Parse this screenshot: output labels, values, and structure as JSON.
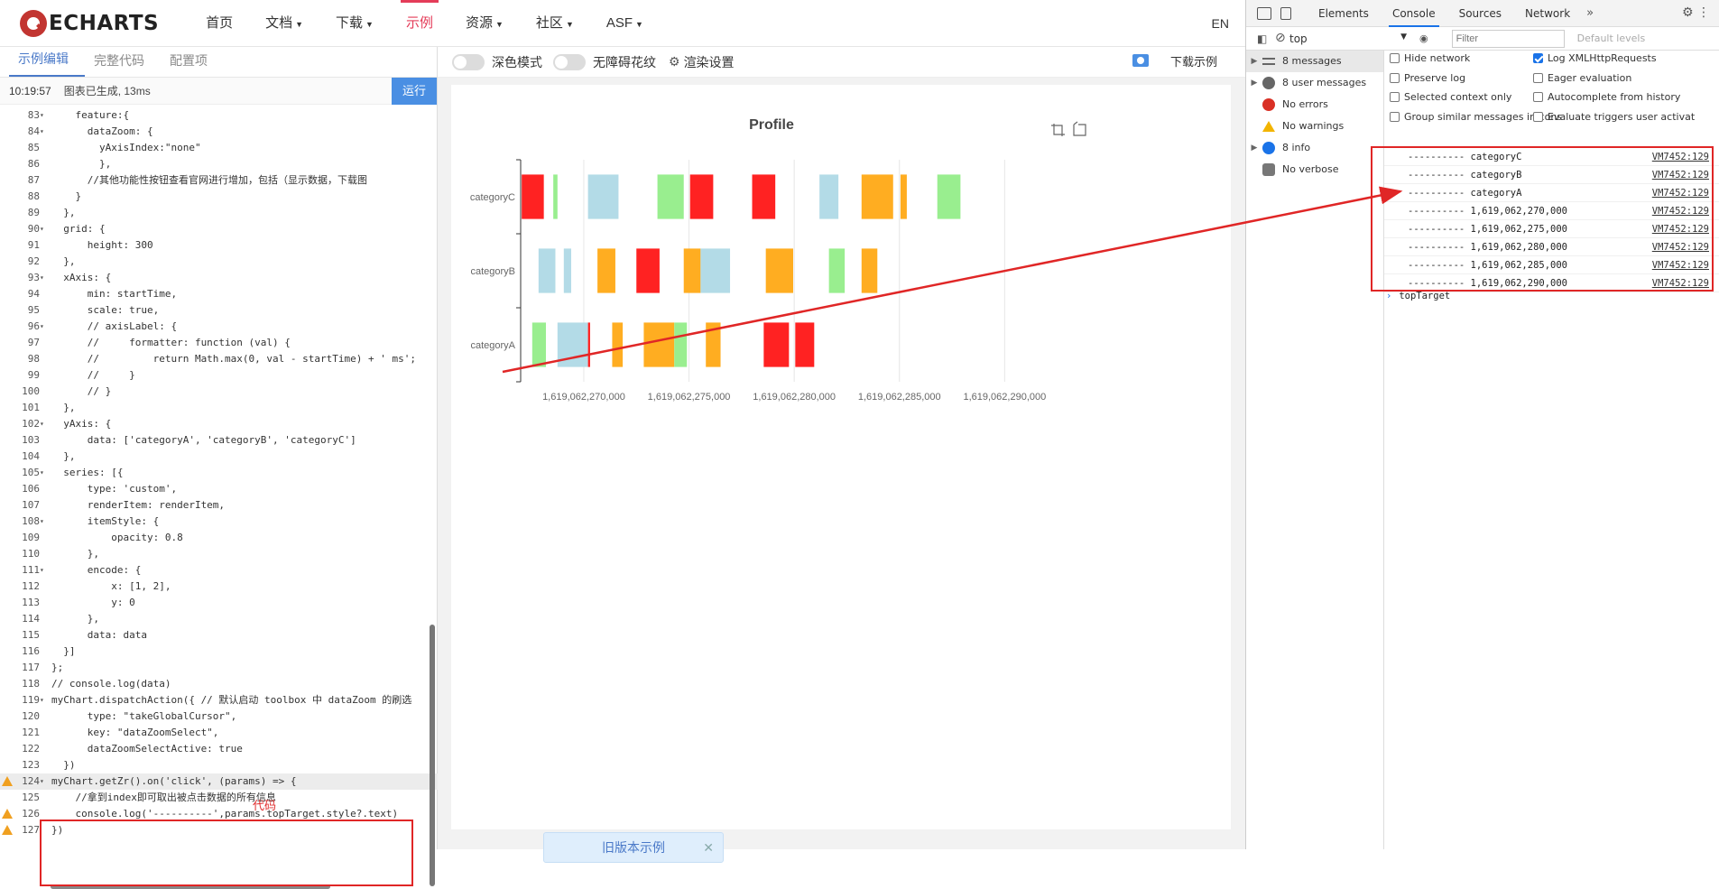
{
  "nav": {
    "logo_text": "ECHARTS",
    "items": [
      {
        "label": "首页",
        "has_caret": false
      },
      {
        "label": "文档",
        "has_caret": true
      },
      {
        "label": "下载",
        "has_caret": true
      },
      {
        "label": "示例",
        "has_caret": false,
        "active": true
      },
      {
        "label": "资源",
        "has_caret": true
      },
      {
        "label": "社区",
        "has_caret": true
      },
      {
        "label": "ASF",
        "has_caret": true
      }
    ],
    "lang": "EN"
  },
  "editor": {
    "tabs": [
      "示例编辑",
      "完整代码",
      "配置项"
    ],
    "status_time": "10:19:57",
    "status_msg": "图表已生成, 13ms",
    "run_label": "运行",
    "annotation": "代码",
    "lines": [
      {
        "n": "83",
        "fold": true,
        "text": "    feature:{"
      },
      {
        "n": "84",
        "fold": true,
        "text": "      dataZoom: {"
      },
      {
        "n": "85",
        "fold": false,
        "text": "        yAxisIndex:\"none\""
      },
      {
        "n": "86",
        "fold": false,
        "text": "        },"
      },
      {
        "n": "87",
        "fold": false,
        "text": "      //其他功能性按钮查看官网进行增加，包括（显示数据，下载图"
      },
      {
        "n": "88",
        "fold": false,
        "text": "    }"
      },
      {
        "n": "89",
        "fold": false,
        "text": "  },"
      },
      {
        "n": "90",
        "fold": true,
        "text": "  grid: {"
      },
      {
        "n": "91",
        "fold": false,
        "text": "      height: 300"
      },
      {
        "n": "92",
        "fold": false,
        "text": "  },"
      },
      {
        "n": "93",
        "fold": true,
        "text": "  xAxis: {"
      },
      {
        "n": "94",
        "fold": false,
        "text": "      min: startTime,"
      },
      {
        "n": "95",
        "fold": false,
        "text": "      scale: true,"
      },
      {
        "n": "96",
        "fold": true,
        "text": "      // axisLabel: {"
      },
      {
        "n": "97",
        "fold": false,
        "text": "      //     formatter: function (val) {"
      },
      {
        "n": "98",
        "fold": false,
        "text": "      //         return Math.max(0, val - startTime) + ' ms';"
      },
      {
        "n": "99",
        "fold": false,
        "text": "      //     }"
      },
      {
        "n": "100",
        "fold": false,
        "text": "      // }"
      },
      {
        "n": "101",
        "fold": false,
        "text": "  },"
      },
      {
        "n": "102",
        "fold": true,
        "text": "  yAxis: {"
      },
      {
        "n": "103",
        "fold": false,
        "text": "      data: ['categoryA', 'categoryB', 'categoryC']"
      },
      {
        "n": "104",
        "fold": false,
        "text": "  },"
      },
      {
        "n": "105",
        "fold": true,
        "text": "  series: [{"
      },
      {
        "n": "106",
        "fold": false,
        "text": "      type: 'custom',"
      },
      {
        "n": "107",
        "fold": false,
        "text": "      renderItem: renderItem,"
      },
      {
        "n": "108",
        "fold": true,
        "text": "      itemStyle: {"
      },
      {
        "n": "109",
        "fold": false,
        "text": "          opacity: 0.8"
      },
      {
        "n": "110",
        "fold": false,
        "text": "      },"
      },
      {
        "n": "111",
        "fold": true,
        "text": "      encode: {"
      },
      {
        "n": "112",
        "fold": false,
        "text": "          x: [1, 2],"
      },
      {
        "n": "113",
        "fold": false,
        "text": "          y: 0"
      },
      {
        "n": "114",
        "fold": false,
        "text": "      },"
      },
      {
        "n": "115",
        "fold": false,
        "text": "      data: data"
      },
      {
        "n": "116",
        "fold": false,
        "text": "  }]"
      },
      {
        "n": "117",
        "fold": false,
        "text": "};"
      },
      {
        "n": "118",
        "fold": false,
        "text": "// console.log(data)"
      },
      {
        "n": "119",
        "fold": true,
        "text": "myChart.dispatchAction({ // 默认启动 toolbox 中 dataZoom 的刷选"
      },
      {
        "n": "120",
        "fold": false,
        "text": "      type: \"takeGlobalCursor\","
      },
      {
        "n": "121",
        "fold": false,
        "text": "      key: \"dataZoomSelect\","
      },
      {
        "n": "122",
        "fold": false,
        "text": "      dataZoomSelectActive: true"
      },
      {
        "n": "123",
        "fold": false,
        "text": "  })"
      },
      {
        "n": "124",
        "fold": true,
        "warn": true,
        "text": "myChart.getZr().on('click', (params) => {"
      },
      {
        "n": "125",
        "fold": false,
        "text": "    //拿到index即可取出被点击数据的所有信息"
      },
      {
        "n": "126",
        "fold": false,
        "warn": true,
        "text": "    console.log('----------',params.topTarget.style?.text)"
      },
      {
        "n": "127",
        "fold": false,
        "warn": true,
        "text": "})"
      }
    ]
  },
  "chart_toolbar": {
    "dark_mode": "深色模式",
    "accessibility": "无障碍花纹",
    "render_settings": "渲染设置",
    "download": "下载示例"
  },
  "old_version_label": "旧版本示例",
  "chart_data": {
    "type": "custom-profile",
    "title": "Profile",
    "categories": [
      "categoryA",
      "categoryB",
      "categoryC"
    ],
    "xlim": [
      1619062267000,
      1619062292000
    ],
    "x_ticks": [
      1619062270000,
      1619062275000,
      1619062280000,
      1619062285000,
      1619062290000
    ],
    "x_tick_labels": [
      "1,619,062,270,000",
      "1,619,062,275,000",
      "1,619,062,280,000",
      "1,619,062,285,000",
      "1,619,062,290,000"
    ],
    "colors": {
      "red": "#ff2222",
      "green": "#99ee8f",
      "blue": "#b3dbe7",
      "orange": "#ffad21"
    },
    "items": [
      {
        "cat": "categoryC",
        "start": 1619062267050,
        "end": 1619062268100,
        "color": "red"
      },
      {
        "cat": "categoryC",
        "start": 1619062268550,
        "end": 1619062268750,
        "color": "green"
      },
      {
        "cat": "categoryC",
        "start": 1619062270200,
        "end": 1619062271650,
        "color": "blue"
      },
      {
        "cat": "categoryC",
        "start": 1619062273500,
        "end": 1619062274750,
        "color": "green"
      },
      {
        "cat": "categoryC",
        "start": 1619062275050,
        "end": 1619062276150,
        "color": "red"
      },
      {
        "cat": "categoryC",
        "start": 1619062278000,
        "end": 1619062279100,
        "color": "red"
      },
      {
        "cat": "categoryC",
        "start": 1619062281200,
        "end": 1619062282100,
        "color": "blue"
      },
      {
        "cat": "categoryC",
        "start": 1619062283200,
        "end": 1619062284700,
        "color": "orange"
      },
      {
        "cat": "categoryC",
        "start": 1619062285050,
        "end": 1619062285350,
        "color": "orange"
      },
      {
        "cat": "categoryC",
        "start": 1619062286800,
        "end": 1619062287900,
        "color": "green"
      },
      {
        "cat": "categoryB",
        "start": 1619062267850,
        "end": 1619062268650,
        "color": "blue"
      },
      {
        "cat": "categoryB",
        "start": 1619062269050,
        "end": 1619062269400,
        "color": "blue"
      },
      {
        "cat": "categoryB",
        "start": 1619062270650,
        "end": 1619062271500,
        "color": "orange"
      },
      {
        "cat": "categoryB",
        "start": 1619062272500,
        "end": 1619062273600,
        "color": "red"
      },
      {
        "cat": "categoryB",
        "start": 1619062274750,
        "end": 1619062275550,
        "color": "orange"
      },
      {
        "cat": "categoryB",
        "start": 1619062275550,
        "end": 1619062276950,
        "color": "blue"
      },
      {
        "cat": "categoryB",
        "start": 1619062278650,
        "end": 1619062279950,
        "color": "orange"
      },
      {
        "cat": "categoryB",
        "start": 1619062281650,
        "end": 1619062282400,
        "color": "green"
      },
      {
        "cat": "categoryB",
        "start": 1619062283200,
        "end": 1619062283950,
        "color": "orange"
      },
      {
        "cat": "categoryA",
        "start": 1619062267550,
        "end": 1619062268200,
        "color": "green"
      },
      {
        "cat": "categoryA",
        "start": 1619062268750,
        "end": 1619062270200,
        "color": "blue"
      },
      {
        "cat": "categoryA",
        "start": 1619062270200,
        "end": 1619062270300,
        "color": "red"
      },
      {
        "cat": "categoryA",
        "start": 1619062271350,
        "end": 1619062271850,
        "color": "orange"
      },
      {
        "cat": "categoryA",
        "start": 1619062272850,
        "end": 1619062274300,
        "color": "orange"
      },
      {
        "cat": "categoryA",
        "start": 1619062274300,
        "end": 1619062274900,
        "color": "green"
      },
      {
        "cat": "categoryA",
        "start": 1619062275800,
        "end": 1619062276500,
        "color": "orange"
      },
      {
        "cat": "categoryA",
        "start": 1619062278550,
        "end": 1619062279750,
        "color": "red"
      },
      {
        "cat": "categoryA",
        "start": 1619062280050,
        "end": 1619062280950,
        "color": "red"
      }
    ]
  },
  "devtools": {
    "tabs": [
      "Elements",
      "Console",
      "Sources",
      "Network"
    ],
    "context": "top",
    "filter_placeholder": "Filter",
    "levels": "Default levels",
    "sidebar": [
      {
        "label": "8 messages",
        "icon": "list-icon",
        "arrow": true,
        "selected": true
      },
      {
        "label": "8 user messages",
        "icon": "user-icon",
        "arrow": true
      },
      {
        "label": "No errors",
        "icon": "error-icon",
        "arrow": false
      },
      {
        "label": "No warnings",
        "icon": "warning-icon",
        "arrow": false
      },
      {
        "label": "8 info",
        "icon": "info-icon",
        "arrow": true
      },
      {
        "label": "No verbose",
        "icon": "verbose-icon",
        "arrow": false
      }
    ],
    "settings": [
      {
        "label": "Hide network",
        "checked": false
      },
      {
        "label": "Log XMLHttpRequests",
        "checked": true
      },
      {
        "label": "Preserve log",
        "checked": false
      },
      {
        "label": "Eager evaluation",
        "checked": false
      },
      {
        "label": "Selected context only",
        "checked": false
      },
      {
        "label": "Autocomplete from history",
        "checked": false
      },
      {
        "label": "Group similar messages in cons",
        "checked": false
      },
      {
        "label": "Evaluate triggers user activat",
        "checked": false
      }
    ],
    "logs": [
      {
        "text": "---------- categoryC",
        "src": "VM7452:129"
      },
      {
        "text": "---------- categoryB",
        "src": "VM7452:129"
      },
      {
        "text": "---------- categoryA",
        "src": "VM7452:129"
      },
      {
        "text": "---------- 1,619,062,270,000",
        "src": "VM7452:129"
      },
      {
        "text": "---------- 1,619,062,275,000",
        "src": "VM7452:129"
      },
      {
        "text": "---------- 1,619,062,280,000",
        "src": "VM7452:129"
      },
      {
        "text": "---------- 1,619,062,285,000",
        "src": "VM7452:129"
      },
      {
        "text": "---------- 1,619,062,290,000",
        "src": "VM7452:129"
      }
    ],
    "prompt_text": "topTarget"
  }
}
